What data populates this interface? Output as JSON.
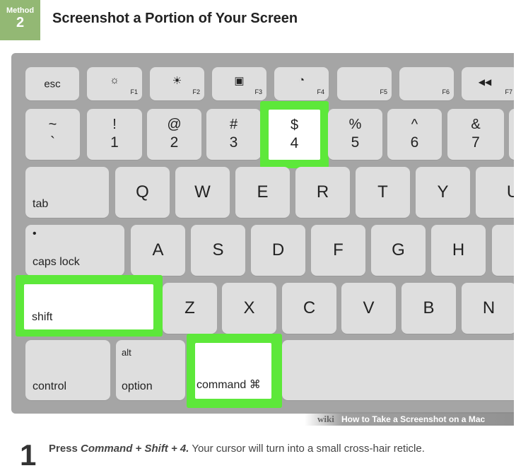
{
  "header": {
    "method_label": "Method",
    "method_number": "2",
    "title": "Screenshot a Portion of Your Screen"
  },
  "keyboard": {
    "row_fn": [
      {
        "label": "esc"
      },
      {
        "icon": "brightness-down-icon",
        "glyph": "☼",
        "fn": "F1"
      },
      {
        "icon": "brightness-up-icon",
        "glyph": "☀",
        "fn": "F2"
      },
      {
        "icon": "mission-control-icon",
        "glyph": "▣",
        "fn": "F3"
      },
      {
        "icon": "dashboard-icon",
        "glyph": "◔",
        "fn": "F4"
      },
      {
        "fn": "F5"
      },
      {
        "fn": "F6"
      },
      {
        "icon": "rewind-icon",
        "glyph": "◀◀",
        "fn": "F7"
      }
    ],
    "row_num": [
      {
        "top": "~",
        "bot": "`"
      },
      {
        "top": "!",
        "bot": "1"
      },
      {
        "top": "@",
        "bot": "2"
      },
      {
        "top": "#",
        "bot": "3"
      },
      {
        "top": "$",
        "bot": "4",
        "highlighted": true
      },
      {
        "top": "%",
        "bot": "5"
      },
      {
        "top": "^",
        "bot": "6"
      },
      {
        "top": "&",
        "bot": "7"
      }
    ],
    "row_q": [
      "Q",
      "W",
      "E",
      "R",
      "T",
      "Y",
      "U"
    ],
    "row_a": [
      "A",
      "S",
      "D",
      "F",
      "G",
      "H"
    ],
    "row_z": [
      "Z",
      "X",
      "C",
      "V",
      "B",
      "N"
    ],
    "tab": "tab",
    "caps_lock": "caps lock",
    "caps_dot": "•",
    "shift": "shift",
    "control": "control",
    "option": "option",
    "option_alt": "alt",
    "command": "command ⌘",
    "highlight_color": "#5de83a"
  },
  "watermark": {
    "wiki": "wiki",
    "caption": "How to Take a Screenshot on a Mac"
  },
  "step": {
    "number": "1",
    "press": "Press",
    "keys": "Command + Shift + 4.",
    "rest": "Your cursor will turn into a small cross-hair reticle."
  }
}
